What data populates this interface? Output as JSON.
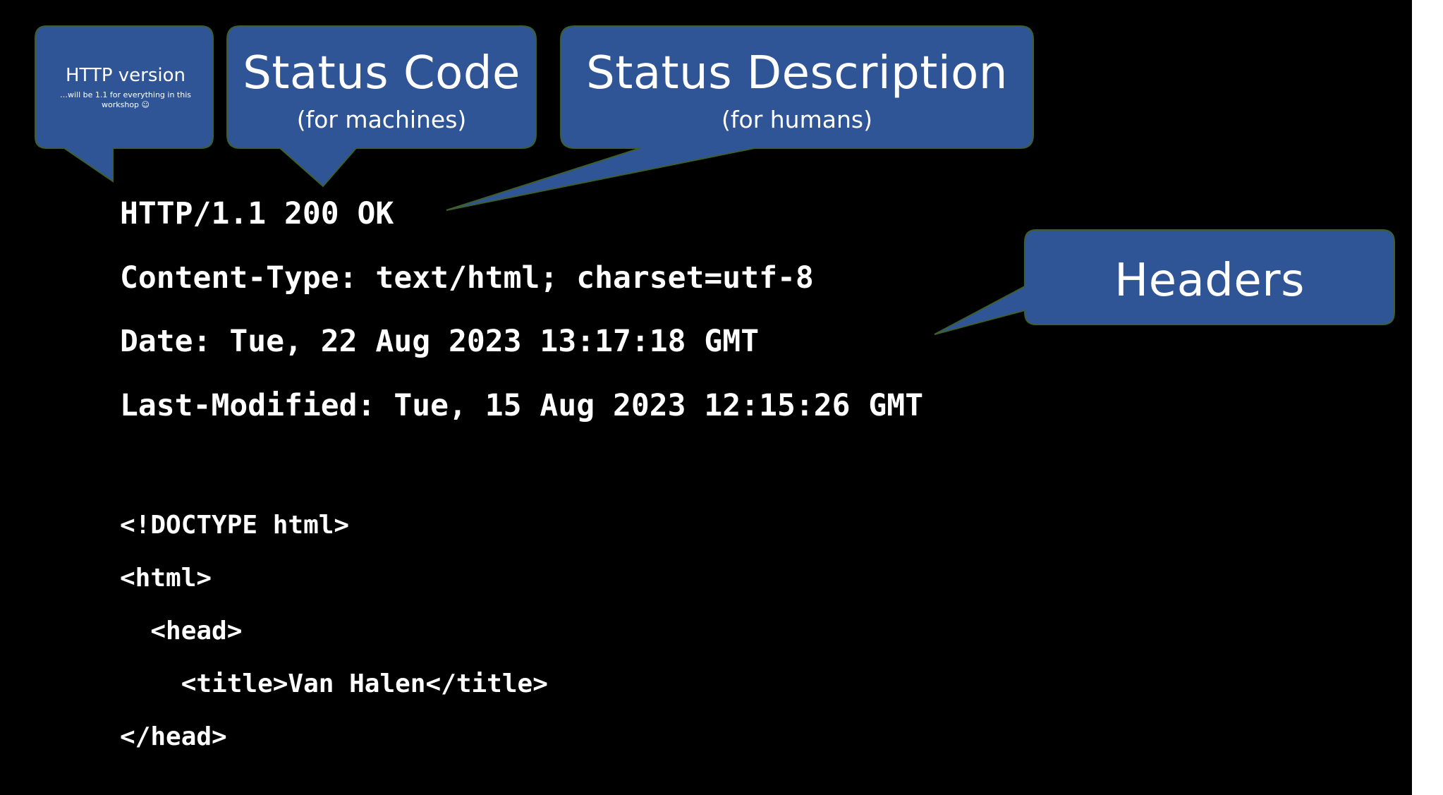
{
  "callouts": {
    "http_version": {
      "title": "HTTP version",
      "note": "…will be 1.1 for everything in this workshop ☺"
    },
    "status_code": {
      "title": "Status Code",
      "subtitle": "(for machines)"
    },
    "status_description": {
      "title": "Status Description",
      "subtitle": "(for humans)"
    },
    "headers": {
      "title": "Headers"
    }
  },
  "response": {
    "status_line": "HTTP/1.1 200 OK",
    "headers": [
      "Content-Type: text/html; charset=utf-8",
      "Date: Tue, 22 Aug 2023 13:17:18 GMT",
      "Last-Modified: Tue, 15 Aug 2023 12:15:26 GMT"
    ],
    "body": [
      "<!DOCTYPE html>",
      "<html>",
      "  <head>",
      "    <title>Van Halen</title>",
      "</head>"
    ]
  },
  "colors": {
    "background": "#000000",
    "callout_fill": "#2f5597",
    "callout_stroke": "#2e4a2a",
    "text": "#ffffff"
  }
}
